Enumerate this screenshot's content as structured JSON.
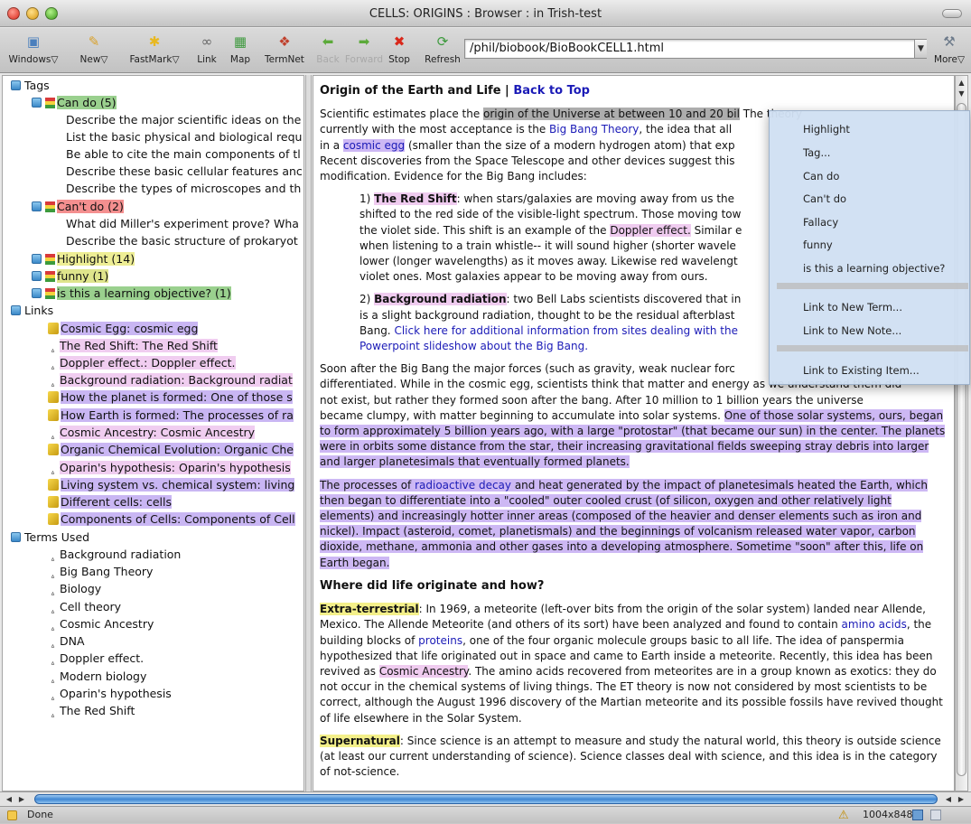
{
  "window": {
    "title": "CELLS: ORIGINS : Browser : in Trish-test"
  },
  "toolbar": {
    "buttons": [
      {
        "label": "Windows▽",
        "icon": "windows-icon"
      },
      {
        "label": "New▽",
        "icon": "new-icon"
      },
      {
        "label": "FastMark▽",
        "icon": "fastmark-icon"
      },
      {
        "label": "Link",
        "icon": "link-icon"
      },
      {
        "label": "Map",
        "icon": "map-icon"
      },
      {
        "label": "TermNet",
        "icon": "termnet-icon"
      },
      {
        "label": "Back",
        "icon": "back-arrow-icon"
      },
      {
        "label": "Forward",
        "icon": "forward-arrow-icon"
      },
      {
        "label": "Stop",
        "icon": "stop-icon"
      },
      {
        "label": "Refresh",
        "icon": "refresh-icon"
      },
      {
        "label": "More▽",
        "icon": "more-icon"
      }
    ],
    "url": "/phil/biobook/BioBookCELL1.html"
  },
  "sidebar": {
    "tags_header": "Tags",
    "can_do": "Can do (5)",
    "can_do_items": [
      "Describe the major scientific ideas on the",
      "List the basic physical and biological requ",
      "Be able to cite the main components of tl",
      "Describe these basic cellular features anc",
      "Describe the types of microscopes and th"
    ],
    "cant_do": "Can't do (2)",
    "cant_do_items": [
      "What did Miller's experiment prove? Wha",
      "Describe the basic structure of prokaryot"
    ],
    "highlight": "Highlight (14)",
    "funny": "funny (1)",
    "learning_objective": "is this a learning objective? (1)",
    "links_header": "Links",
    "links": [
      "Cosmic Egg: cosmic egg",
      "The Red Shift: The Red Shift",
      "Doppler effect.: Doppler effect.",
      "Background radiation: Background radiat",
      "How the planet is formed: One of those s",
      "How Earth is formed: The processes of ra",
      "Cosmic Ancestry: Cosmic Ancestry",
      "Organic Chemical Evolution: Organic Che",
      "Oparin's hypothesis: Oparin's hypothesis",
      "Living system vs. chemical system: living",
      "Different cells: cells",
      "Components of Cells: Components of Cell"
    ],
    "terms_header": "Terms Used",
    "terms": [
      "Background radiation",
      "Big Bang Theory",
      "Biology",
      "Cell theory",
      "Cosmic Ancestry",
      "DNA",
      "Doppler effect.",
      "Modern biology",
      "Oparin's hypothesis",
      "The Red Shift"
    ]
  },
  "content": {
    "heading1": "Origin of the Earth and Life",
    "heading1_sep": " | ",
    "back_to_top": "Back to Top",
    "p1": {
      "a": "Scientific estimates place the ",
      "sel": "origin of the Universe at between 10 and 20 bil",
      "b": " The theory",
      "c": "currently with the most acceptance is the ",
      "big_bang": "Big Bang Theory",
      "d": ", the idea that all",
      "e": "in a ",
      "cosmic_egg": "cosmic egg",
      "f": " (smaller than the size of a modern hydrogen atom) that exp",
      "g": "Recent discoveries from the Space Telescope and other devices suggest this",
      "h": "modification. Evidence for the Big Bang includes:"
    },
    "p2": {
      "num": "1) ",
      "red_shift": "The Red Shift",
      "a": ": when stars/galaxies are moving away from us the",
      "b": "shifted to the red side of the visible-light spectrum. Those moving tow",
      "c": "the violet side. This shift is an example of the ",
      "doppler": "Doppler effect.",
      "d": " Similar e",
      "e": "when listening to a train whistle-- it will sound higher (shorter wavele",
      "f": "lower (longer wavelengths) as it moves away. Likewise red wavelengt",
      "g": "violet ones. Most galaxies appear to be moving away from ours."
    },
    "p3": {
      "num": "2) ",
      "bg_rad": "Background radiation",
      "a": ": two Bell Labs scientists discovered that in",
      "b": "is a slight background radiation, thought to be the residual afterblast",
      "c": "Bang. ",
      "link": "Click here for additional information from sites dealing with the",
      "link2": "Powerpoint slideshow about the Big Bang."
    },
    "p4": {
      "a": "Soon after the Big Bang the major forces (such as gravity, weak nuclear forc",
      "b": "differentiated. While in the cosmic egg, scientists think that matter and energy as we understand them did",
      "c": "not exist, but rather they formed soon after the bang. After 10 million to 1 billion years the universe",
      "d": "became clumpy, with matter beginning to accumulate into solar systems. ",
      "sel": "One of those solar systems, ours, began to form approximately 5 billion years ago, with a large \"protostar\" (that became our sun) in the center. The planets were in orbits some distance from the star, their increasing gravitational fields sweeping stray debris into larger and larger planetesimals that eventually formed planets."
    },
    "p5": {
      "a": "The processes of ",
      "radioactive": "radioactive decay",
      "b": " and heat generated by the impact of planetesimals heated the Earth, which then began to differentiate into a \"cooled\" outer cooled crust (of silicon, oxygen and other relatively light elements) and increasingly hotter inner areas (composed of the heavier and denser elements such as iron and nickel). Impact (asteroid, comet, planetismals) and the beginnings of volcanism released water vapor, carbon dioxide, methane, ammonia and other gases into a developing atmosphere. Sometime \"soon\" after this, life on Earth began."
    },
    "heading2": "Where did life originate and how?",
    "p6": {
      "extra": "Extra-terrestrial",
      "a": ": In 1969, a meteorite (left-over bits from the origin of the solar system) landed near Allende, Mexico. The Allende Meteorite (and others of its sort) have been analyzed and found to contain ",
      "amino": "amino acids",
      "b": ", the building blocks of ",
      "proteins": "proteins",
      "c": ", one of the four organic molecule groups basic to all life. The idea of panspermia hypothesized that life originated out in space and came to Earth inside a meteorite. Recently, this idea has been revived as ",
      "cosmic_ancestry": "Cosmic Ancestry",
      "d": ". The amino acids recovered from meteorites are in a group known as exotics: they do not occur in the chemical systems of living things. The ET theory is now not considered by most scientists to be correct, although the August 1996 discovery of the Martian meteorite and its possible fossils have revived thought of life elsewhere in the Solar System."
    },
    "p7": {
      "super": "Supernatural",
      "a": ": Since science is an attempt to measure and study the natural world, this theory is outside science (at least our current understanding of science). Science classes deal with science, and this idea is in the category of not-science."
    }
  },
  "context_menu": {
    "items": [
      "Highlight",
      "Tag...",
      "Can do",
      "Can't do",
      "Fallacy",
      "funny",
      "is this a learning objective?",
      "Link to New Term...",
      "Link to New Note...",
      "Link to Existing Item..."
    ]
  },
  "status": {
    "text": "Done",
    "dimensions": "1004x848"
  },
  "colors": {
    "tag_green": "#9ad08e",
    "tag_red": "#f48f8f",
    "tag_yellow": "#eeee95",
    "link_pink": "#f0cdf0",
    "link_purple": "#c9b6f3",
    "link_text": "#1b1bb7"
  }
}
